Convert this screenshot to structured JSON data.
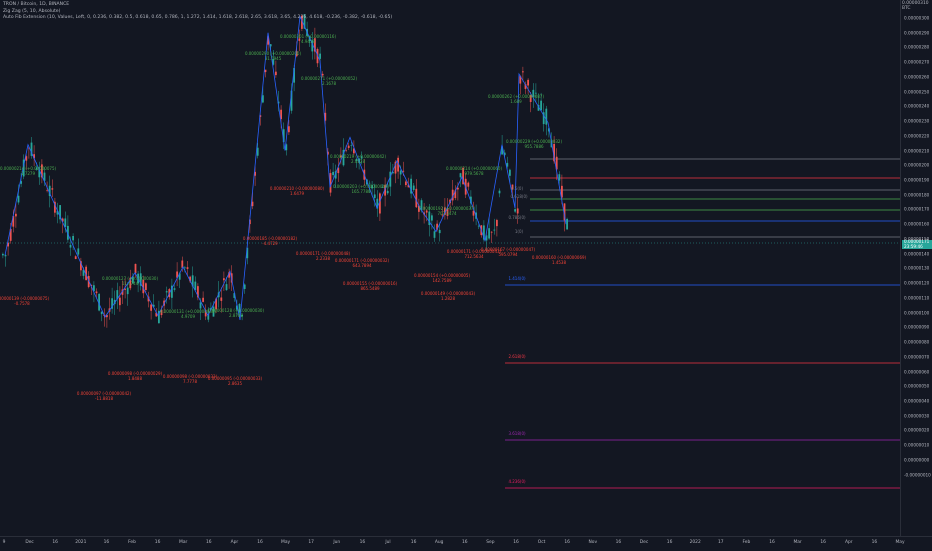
{
  "legend": {
    "symbol": "TRON / Bitcoin, 1D, BINANCE",
    "indicator1": "Zig Zag (5, 10, Absolute)",
    "indicator2": "Auto Fib Extension (10, Values, Left, 0, 0.236, 0.382, 0.5, 0.618, 0.65, 0.786, 1, 1.272, 1.414, 1.618, 2.618, 2.65, 3.618, 3.65, 4.236, 4.618, -0.236, -0.382, -0.618, -0.65)"
  },
  "price_scale": {
    "currency": "BTC",
    "top_label": "0.00000310",
    "ticks": [
      "0.00000300",
      "0.00000290",
      "0.00000280",
      "0.00000270",
      "0.00000260",
      "0.00000250",
      "0.00000240",
      "0.00000230",
      "0.00000220",
      "0.00000210",
      "0.00000200",
      "0.00000190",
      "0.00000180",
      "0.00000170",
      "0.00000160",
      "0.00000150",
      "0.00000140",
      "0.00000130",
      "0.00000120",
      "0.00000110",
      "0.00000100",
      "0.00000090",
      "0.00000080",
      "0.00000070",
      "0.00000060",
      "0.00000050",
      "0.00000040",
      "0.00000030",
      "0.00000020",
      "0.00000010",
      "0.00000000",
      "-0.00000010"
    ],
    "current_price": "0.00000171",
    "current_time": "23:59:46"
  },
  "time_scale": {
    "labels": [
      "9",
      "Dec",
      "16",
      "2021",
      "16",
      "Feb",
      "16",
      "Mar",
      "16",
      "Apr",
      "16",
      "May",
      "17",
      "Jun",
      "16",
      "Jul",
      "16",
      "Aug",
      "16",
      "Sep",
      "16",
      "Oct",
      "16",
      "Nov",
      "16",
      "Dec",
      "16",
      "2022",
      "17",
      "Feb",
      "16",
      "Mar",
      "16",
      "Apr",
      "16",
      "May"
    ]
  },
  "zigzag_labels": [
    {
      "text": "0.00000214 (+0.00000075)",
      "sub": "1.7279",
      "color": "#4caf50"
    },
    {
      "text": "0.00000139 (-0.00000075)",
      "sub": "-0.7578",
      "color": "#f44336"
    },
    {
      "text": "0.00000097 (-0.00000042)",
      "sub": "-11.8818",
      "color": "#f44336"
    },
    {
      "text": "0.00000127 (+0.00000030)",
      "sub": "11.4744",
      "color": "#4caf50"
    },
    {
      "text": "0.00000098 (-0.00000029)",
      "sub": "1.8488",
      "color": "#f44336"
    },
    {
      "text": "0.00000131 (+0.00000033)",
      "sub": "4.9709",
      "color": "#4caf50"
    },
    {
      "text": "0.00000098 (-0.00000033)",
      "sub": "7.7778",
      "color": "#f44336"
    },
    {
      "text": "0.00000128 (+0.00000030)",
      "sub": "2.8788",
      "color": "#4caf50"
    },
    {
      "text": "0.00000095 (-0.00000033)",
      "sub": "2.8635",
      "color": "#f44336"
    },
    {
      "text": "0.00000290 (+0.00000200)",
      "sub": "31.5945",
      "color": "#4caf50"
    },
    {
      "text": "0.00000210 (-0.00000080)",
      "sub": "1.6479",
      "color": "#f44336"
    },
    {
      "text": "0.00000301 (+0.00000116)",
      "sub": "4.9419",
      "color": "#4caf50"
    },
    {
      "text": "0.00000271 (+0.00000052)",
      "sub": "2.1678",
      "color": "#4caf50"
    },
    {
      "text": "0.00000185 (-0.00000182)",
      "sub": "-4.4729",
      "color": "#f44336"
    },
    {
      "text": "0.00000219 (+0.00000042)",
      "sub": "2.0528",
      "color": "#4caf50"
    },
    {
      "text": "0.00000171 (-0.00000048)",
      "sub": "2.2338",
      "color": "#f44336"
    },
    {
      "text": "0.00000203 (+0.00000049)",
      "sub": "165.7780",
      "color": "#4caf50"
    },
    {
      "text": "0.00000171 (-0.00000032)",
      "sub": "643.7894",
      "color": "#f44336"
    },
    {
      "text": "0.00000155 (-0.00000016)",
      "sub": "865.5489",
      "color": "#f44336"
    },
    {
      "text": "0.00000192 (+0.00000037)",
      "sub": "707.3474",
      "color": "#4caf50"
    },
    {
      "text": "0.00000149 (-0.00000043)",
      "sub": "1.2828",
      "color": "#f44336"
    },
    {
      "text": "0.00000154 (+0.00000005)",
      "sub": "142.7589",
      "color": "#f44336"
    },
    {
      "text": "0.00000214 (+0.00000060)",
      "sub": "979.5678",
      "color": "#4caf50"
    },
    {
      "text": "0.00000171 (-0.00000043)",
      "sub": "712.5634",
      "color": "#f44336"
    },
    {
      "text": "0.00000167 (-0.00000047)",
      "sub": "595.0794",
      "color": "#f44336"
    },
    {
      "text": "0.00000262 (+0.00000087)",
      "sub": "1.689",
      "color": "#4caf50"
    },
    {
      "text": "0.00000229 (+0.00000032)",
      "sub": "955.7886",
      "color": "#4caf50"
    },
    {
      "text": "0.00000160 (-0.00000069)",
      "sub": "1.4538",
      "color": "#f44336"
    }
  ],
  "fib_labels": [
    {
      "text": "1.414(0)",
      "color": "#2962ff"
    },
    {
      "text": "2.618(0)",
      "color": "#f23645"
    },
    {
      "text": "3.618(0)",
      "color": "#9c27b0"
    },
    {
      "text": "4.236(0)",
      "color": "#e91e63"
    },
    {
      "text": "1(0)",
      "color": "#787b86"
    },
    {
      "text": "0.786(0)",
      "color": "#787b86"
    },
    {
      "text": "0.618(0)",
      "color": "#787b86"
    },
    {
      "text": "0.5(0)",
      "color": "#787b86"
    }
  ],
  "colors": {
    "background": "#131722",
    "up": "#26a69a",
    "down": "#ef5350",
    "zigzag": "#2962ff"
  }
}
